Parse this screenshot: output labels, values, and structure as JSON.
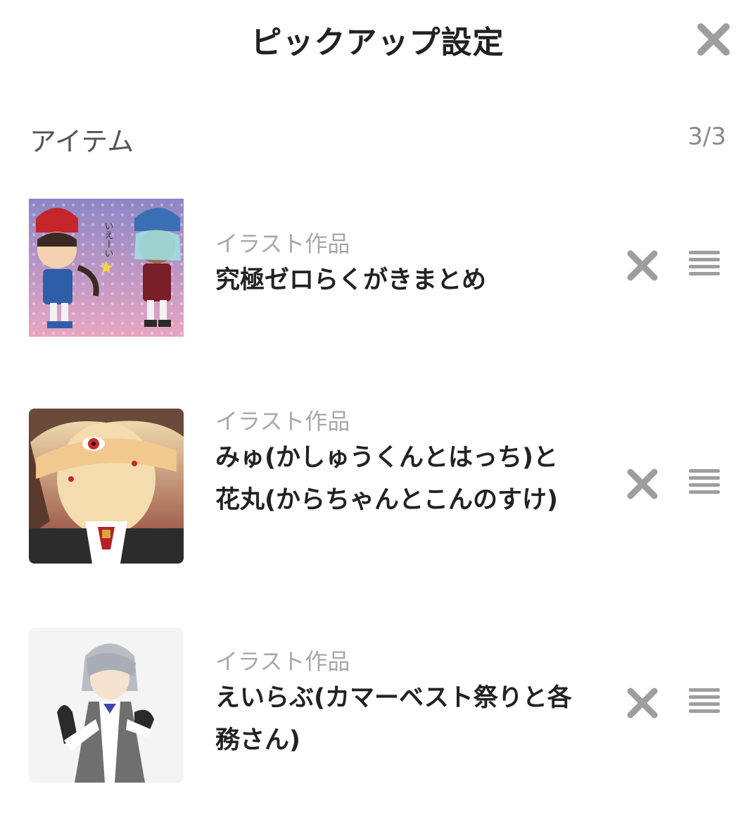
{
  "header": {
    "title": "ピックアップ設定",
    "close_icon": "close-icon"
  },
  "section": {
    "title": "アイテム",
    "count": "3/3"
  },
  "items": [
    {
      "category": "イラスト作品",
      "title": "究極ゼロらくがきまとめ",
      "thumbnail_icon": "illustration-thumbnail",
      "thumbnail_caption": "いえーい",
      "remove_icon": "close-icon",
      "drag_icon": "drag-handle-icon"
    },
    {
      "category": "イラスト作品",
      "title": "みゅ(かしゅうくんとはっち)と花丸(からちゃんとこんのすけ)",
      "thumbnail_icon": "illustration-thumbnail",
      "remove_icon": "close-icon",
      "drag_icon": "drag-handle-icon"
    },
    {
      "category": "イラスト作品",
      "title": "えいらぶ(カマーベスト祭りと各務さん)",
      "thumbnail_icon": "illustration-thumbnail",
      "remove_icon": "close-icon",
      "drag_icon": "drag-handle-icon"
    }
  ],
  "colors": {
    "icon_gray": "#9e9e9e",
    "text_dark": "#222222",
    "text_muted": "#a8a8a8"
  }
}
